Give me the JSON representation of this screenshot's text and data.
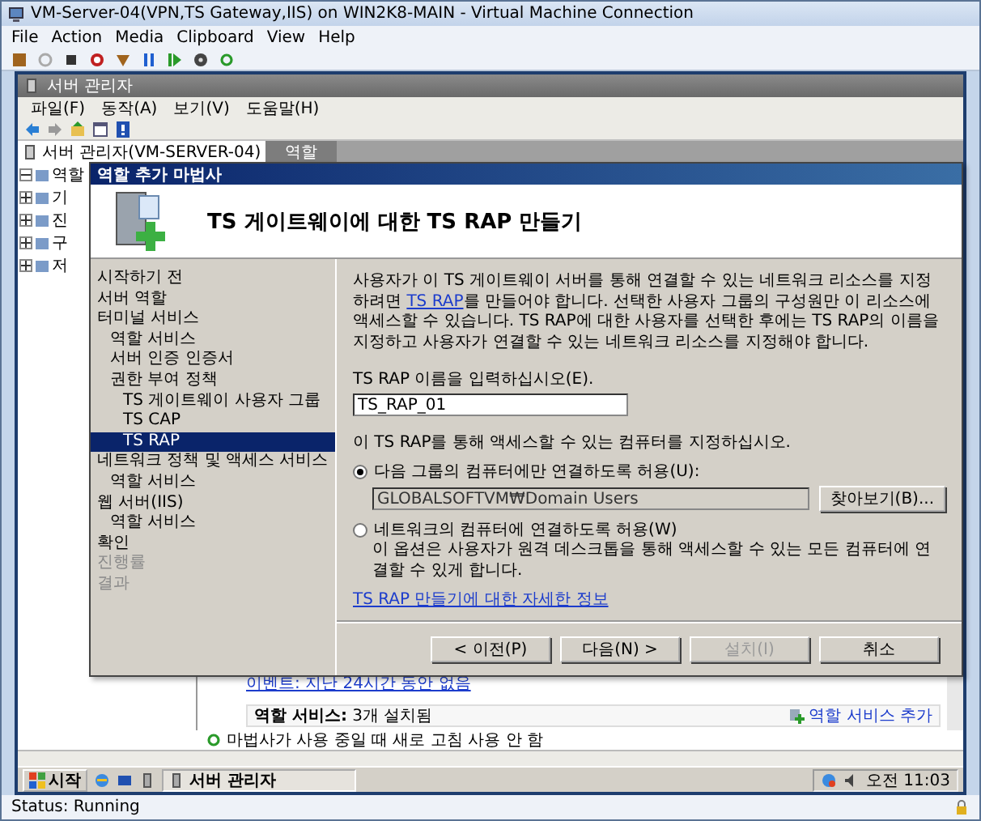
{
  "vm_window": {
    "title": "VM-Server-04(VPN,TS Gateway,IIS) on WIN2K8-MAIN - Virtual Machine Connection",
    "menu": [
      "File",
      "Action",
      "Media",
      "Clipboard",
      "View",
      "Help"
    ],
    "status": "Status: Running"
  },
  "server_manager": {
    "title": "서버 관리자",
    "menu": [
      "파일(F)",
      "동작(A)",
      "보기(V)",
      "도움말(H)"
    ],
    "tree_root": "서버 관리자(VM-SERVER-04)",
    "tab": "역할",
    "tree": [
      {
        "label": "역할",
        "expanded": true
      },
      {
        "label": "기",
        "expanded": false
      },
      {
        "label": "진",
        "expanded": false
      },
      {
        "label": "구",
        "expanded": false
      },
      {
        "label": "저",
        "expanded": false
      }
    ],
    "events_link": "이벤트: 지난 24시간 동안 없음",
    "role_services": "**역할 서비스:** 3개 설치됨",
    "add_role_services": "역할 서비스 추가",
    "refresh_notice": "마법사가 사용 중일 때 새로 고침 사용 안 함"
  },
  "wizard": {
    "title": "역할 추가 마법사",
    "heading": "TS 게이트웨이에 대한 TS RAP 만들기",
    "steps": [
      {
        "label": "시작하기 전",
        "selected": false,
        "disabled": false
      },
      {
        "label": "서버 역할",
        "selected": false,
        "disabled": false
      },
      {
        "label": "터미널 서비스",
        "selected": false,
        "disabled": false,
        "children": [
          {
            "label": "역할 서비스",
            "selected": false,
            "disabled": false
          },
          {
            "label": "서버 인증 인증서",
            "selected": false,
            "disabled": false
          },
          {
            "label": "권한 부여 정책",
            "selected": false,
            "disabled": false,
            "children": [
              {
                "label": "TS 게이트웨이 사용자 그룹",
                "selected": false,
                "disabled": false
              },
              {
                "label": "TS CAP",
                "selected": false,
                "disabled": false
              },
              {
                "label": "TS RAP",
                "selected": true,
                "disabled": false
              }
            ]
          }
        ]
      },
      {
        "label": "네트워크 정책 및 액세스 서비스",
        "selected": false,
        "disabled": false,
        "children": [
          {
            "label": "역할 서비스",
            "selected": false,
            "disabled": false
          }
        ]
      },
      {
        "label": "웹 서버(IIS)",
        "selected": false,
        "disabled": false,
        "children": [
          {
            "label": "역할 서비스",
            "selected": false,
            "disabled": false
          }
        ]
      },
      {
        "label": "확인",
        "selected": false,
        "disabled": false
      },
      {
        "label": "진행률",
        "selected": false,
        "disabled": true
      },
      {
        "label": "결과",
        "selected": false,
        "disabled": true
      }
    ],
    "description_before": "사용자가 이 TS 게이트웨이 서버를 통해 연결할 수 있는 네트워크 리소스를 지정하려면 ",
    "description_link": "TS RAP",
    "description_after": "를 만들어야 합니다. 선택한 사용자 그룹의 구성원만 이 리소스에 액세스할 수 있습니다. TS RAP에 대한 사용자를 선택한 후에는 TS RAP의 이름을 지정하고 사용자가 연결할 수 있는 네트워크 리소스를 지정해야 합니다.",
    "name_label": "TS RAP 이름을 입력하십시오(E).",
    "name_value": "TS_RAP_01",
    "computers_label": "이 TS RAP를 통해 액세스할 수 있는 컴퓨터를 지정하십시오.",
    "options": [
      {
        "label": "다음 그룹의 컴퓨터에만 연결하도록 허용(U):",
        "selected": true,
        "group_value": "GLOBALSOFTVM₩Domain Users",
        "browse": "찾아보기(B)..."
      },
      {
        "label": "네트워크의 컴퓨터에 연결하도록 허용(W)",
        "selected": false,
        "note": "이 옵션은 사용자가 원격 데스크톱을 통해 액세스할 수 있는 모든 컴퓨터에 연결할 수 있게 합니다."
      }
    ],
    "help_link": "TS RAP 만들기에 대한 자세한 정보",
    "buttons": [
      {
        "label": "< 이전(P)",
        "disabled": false
      },
      {
        "label": "다음(N) >",
        "disabled": false
      },
      {
        "label": "설치(I)",
        "disabled": true
      },
      {
        "label": "취소",
        "disabled": false
      }
    ]
  },
  "taskbar": {
    "start": "시작",
    "task": "서버 관리자",
    "clock": "오전 11:03"
  }
}
